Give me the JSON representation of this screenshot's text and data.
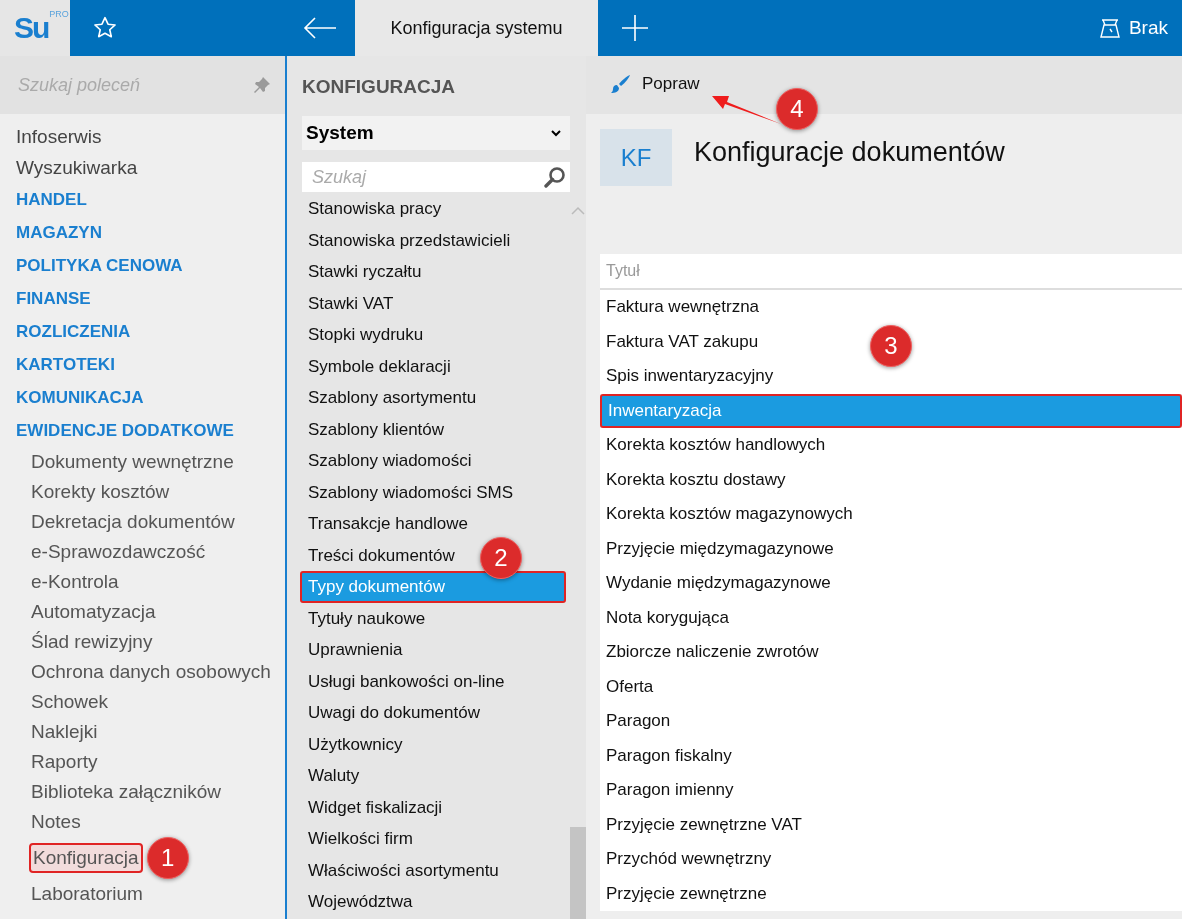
{
  "topbar": {
    "logo": "Su",
    "logo_badge": "PRO",
    "tab": "Konfiguracja systemu",
    "profile": "Brak"
  },
  "sidebar": {
    "search_placeholder": "Szukaj poleceń",
    "items": [
      {
        "label": "Infoserwis",
        "kind": "link",
        "selected": false
      },
      {
        "label": "Wyszukiwarka",
        "kind": "link",
        "selected": false
      },
      {
        "label": "HANDEL",
        "kind": "section",
        "selected": false
      },
      {
        "label": "MAGAZYN",
        "kind": "section",
        "selected": false
      },
      {
        "label": "POLITYKA CENOWA",
        "kind": "section",
        "selected": false
      },
      {
        "label": "FINANSE",
        "kind": "section",
        "selected": false
      },
      {
        "label": "ROZLICZENIA",
        "kind": "section",
        "selected": false
      },
      {
        "label": "KARTOTEKI",
        "kind": "section",
        "selected": false
      },
      {
        "label": "KOMUNIKACJA",
        "kind": "section",
        "selected": false
      },
      {
        "label": "EWIDENCJE DODATKOWE",
        "kind": "section",
        "selected": false
      },
      {
        "label": "Dokumenty wewnętrzne",
        "kind": "sub",
        "selected": false
      },
      {
        "label": "Korekty kosztów",
        "kind": "sub",
        "selected": false
      },
      {
        "label": "Dekretacja dokumentów",
        "kind": "sub",
        "selected": false
      },
      {
        "label": "e-Sprawozdawczość",
        "kind": "sub",
        "selected": false
      },
      {
        "label": "e-Kontrola",
        "kind": "sub",
        "selected": false
      },
      {
        "label": "Automatyzacja",
        "kind": "sub",
        "selected": false
      },
      {
        "label": "Ślad rewizyjny",
        "kind": "sub",
        "selected": false
      },
      {
        "label": "Ochrona danych osobowych",
        "kind": "sub",
        "selected": false
      },
      {
        "label": "Schowek",
        "kind": "sub",
        "selected": false
      },
      {
        "label": "Naklejki",
        "kind": "sub",
        "selected": false
      },
      {
        "label": "Raporty",
        "kind": "sub",
        "selected": false
      },
      {
        "label": "Biblioteka załączników",
        "kind": "sub",
        "selected": false
      },
      {
        "label": "Notes",
        "kind": "sub",
        "selected": false
      },
      {
        "label": "Konfiguracja",
        "kind": "sub",
        "selected": true,
        "callout": "1"
      },
      {
        "label": "Laboratorium",
        "kind": "sub",
        "selected": false
      }
    ]
  },
  "config": {
    "heading": "KONFIGURACJA",
    "group": "System",
    "search_placeholder": "Szukaj",
    "items": [
      {
        "label": "Stanowiska pracy",
        "selected": false
      },
      {
        "label": "Stanowiska przedstawicieli",
        "selected": false
      },
      {
        "label": "Stawki ryczałtu",
        "selected": false
      },
      {
        "label": "Stawki VAT",
        "selected": false
      },
      {
        "label": "Stopki wydruku",
        "selected": false
      },
      {
        "label": "Symbole deklaracji",
        "selected": false
      },
      {
        "label": "Szablony asortymentu",
        "selected": false
      },
      {
        "label": "Szablony klientów",
        "selected": false
      },
      {
        "label": "Szablony wiadomości",
        "selected": false
      },
      {
        "label": "Szablony wiadomości SMS",
        "selected": false
      },
      {
        "label": "Transakcje handlowe",
        "selected": false
      },
      {
        "label": "Treści dokumentów",
        "selected": false
      },
      {
        "label": "Typy dokumentów",
        "selected": true,
        "callout": "2"
      },
      {
        "label": "Tytuły naukowe",
        "selected": false
      },
      {
        "label": "Uprawnienia",
        "selected": false
      },
      {
        "label": "Usługi bankowości on-line",
        "selected": false
      },
      {
        "label": "Uwagi do dokumentów",
        "selected": false
      },
      {
        "label": "Użytkownicy",
        "selected": false
      },
      {
        "label": "Waluty",
        "selected": false
      },
      {
        "label": "Widget fiskalizacji",
        "selected": false
      },
      {
        "label": "Wielkości firm",
        "selected": false
      },
      {
        "label": "Właściwości asortymentu",
        "selected": false
      },
      {
        "label": "Województwa",
        "selected": false
      }
    ]
  },
  "content": {
    "toolbar": {
      "button": "Popraw",
      "callout": "4"
    },
    "tile": "KF",
    "title": "Konfiguracje dokumentów",
    "table": {
      "columns": [
        "Tytuł"
      ],
      "rows": [
        {
          "title": "Faktura wewnętrzna",
          "selected": false
        },
        {
          "title": "Faktura VAT zakupu",
          "selected": false
        },
        {
          "title": "Spis inwentaryzacyjny",
          "selected": false
        },
        {
          "title": "Inwentaryzacja",
          "selected": true,
          "callout": "3"
        },
        {
          "title": "Korekta kosztów handlowych",
          "selected": false
        },
        {
          "title": "Korekta kosztu dostawy",
          "selected": false
        },
        {
          "title": "Korekta kosztów magazynowych",
          "selected": false
        },
        {
          "title": "Przyjęcie międzymagazynowe",
          "selected": false
        },
        {
          "title": "Wydanie międzymagazynowe",
          "selected": false
        },
        {
          "title": "Nota korygująca",
          "selected": false
        },
        {
          "title": "Zbiorcze naliczenie zwrotów",
          "selected": false
        },
        {
          "title": "Oferta",
          "selected": false
        },
        {
          "title": "Paragon",
          "selected": false
        },
        {
          "title": "Paragon fiskalny",
          "selected": false
        },
        {
          "title": "Paragon imienny",
          "selected": false
        },
        {
          "title": "Przyjęcie zewnętrzne VAT",
          "selected": false
        },
        {
          "title": "Przychód wewnętrzny",
          "selected": false
        },
        {
          "title": "Przyjęcie zewnętrzne",
          "selected": false
        }
      ]
    }
  }
}
